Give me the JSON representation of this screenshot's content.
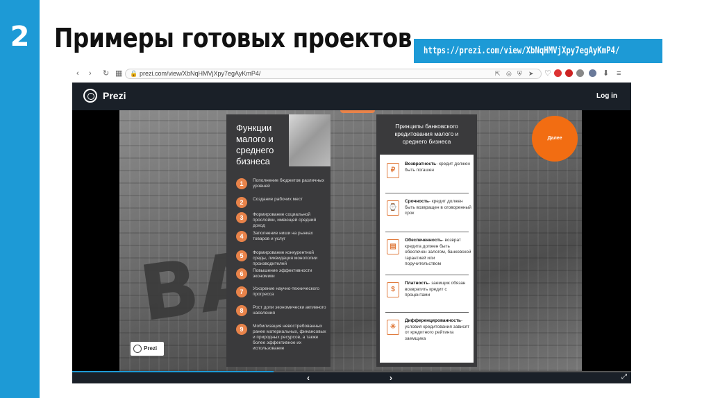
{
  "slide": {
    "number": "2",
    "title": "Примеры готовых проектов",
    "url": "https://prezi.com/view/XbNqHMVjXpy7egAyKmP4/"
  },
  "browser": {
    "address": "prezi.com/view/XbNqHMVjXpy7egAyKmP4/",
    "nav_icons": [
      "back-icon",
      "forward-icon",
      "reload-icon",
      "apps-icon"
    ]
  },
  "prezi": {
    "brand": "Prezi",
    "login": "Log in",
    "next_button": "Далее",
    "progress": 0.36,
    "left_card": {
      "title": "Функции малого и среднего бизнеса",
      "items": [
        {
          "num": "1",
          "text": "Пополнение бюджетов различных уровней"
        },
        {
          "num": "2",
          "text": "Создание рабочих мест"
        },
        {
          "num": "3",
          "text": "Формирование социальной прослойки, имеющей средний доход"
        },
        {
          "num": "4",
          "text": "Заполнение ниши на рынках товаров и услуг"
        },
        {
          "num": "5",
          "text": "Формирование конкурентной среды, ликвидация монополии производителей"
        },
        {
          "num": "6",
          "text": "Повышение эффективности экономики"
        },
        {
          "num": "7",
          "text": "Ускорение научно-технического прогресса"
        },
        {
          "num": "8",
          "text": "Рост доли экономически активного населения"
        },
        {
          "num": "9",
          "text": "Мобилизация невостребованных ранее материальных, финансовых и природных ресурсов, а также более эффективное их использование"
        }
      ]
    },
    "right_card": {
      "title": "Принципы банковского кредитования малого и среднего бизнеса",
      "items": [
        {
          "term": "Возвратность",
          "text": "- кредит должен быть погашен",
          "icon": "₽"
        },
        {
          "term": "Срочность",
          "text": "- кредит должен быть возвращен в оговоренный срок",
          "icon": "⌚"
        },
        {
          "term": "Обеспеченность",
          "text": "- возврат кредита должен быть обеспечен залогом, банковской гарантией или поручительством",
          "icon": "▤"
        },
        {
          "term": "Платность",
          "text": "- заемщик обязан возвратить кредит с процентами",
          "icon": "$"
        },
        {
          "term": "Дифференцированность",
          "text": "- условия кредитования зависят от кредитного рейтинга заемщика",
          "icon": "☀"
        }
      ]
    },
    "controls": {
      "prev": "‹",
      "next": "›",
      "fullscreen": "⤢"
    }
  }
}
